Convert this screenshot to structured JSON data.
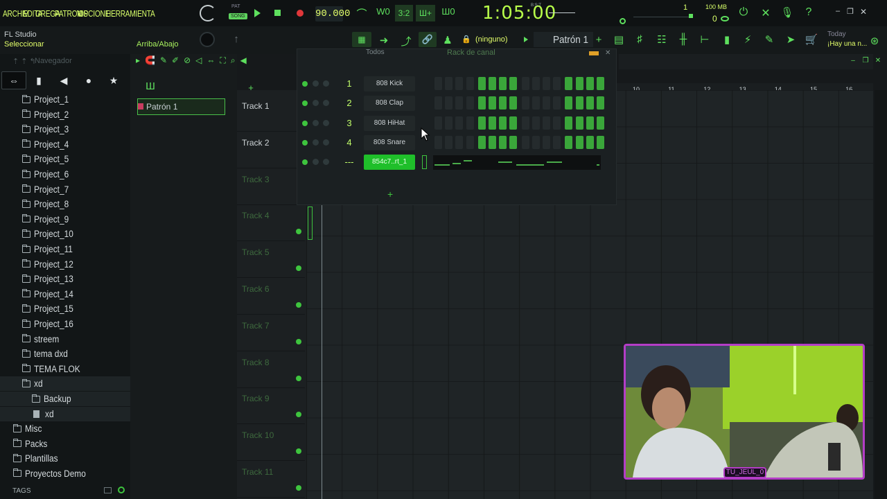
{
  "menu": [
    "ARCHIV",
    "EDITA",
    "GREGA",
    "PATRON",
    "VIS",
    "OPCIONE",
    "HERRAMIENTA"
  ],
  "transport": {
    "pat_label": "PAT",
    "song_label": "SONG",
    "tempo": "90.000",
    "time": "1:05:00",
    "time_unit": "B:S:T",
    "cpu": "1",
    "memory_mb": "100 MB",
    "memory_val": "0"
  },
  "toolbar2": {
    "app_name": "FL Studio",
    "mode": "Seleccionar",
    "updown": "Arriba/Abajo",
    "midi_target": "(ninguno)",
    "pattern": "Patrón 1",
    "news_title": "Today",
    "news_text": "¡Hay una n..."
  },
  "browser": {
    "title": "Navegador",
    "items": [
      {
        "label": "Project_1",
        "type": "folder"
      },
      {
        "label": "Project_2",
        "type": "folder"
      },
      {
        "label": "Project_3",
        "type": "folder"
      },
      {
        "label": "Project_4",
        "type": "folder"
      },
      {
        "label": "Project_5",
        "type": "folder"
      },
      {
        "label": "Project_6",
        "type": "folder"
      },
      {
        "label": "Project_7",
        "type": "folder"
      },
      {
        "label": "Project_8",
        "type": "folder"
      },
      {
        "label": "Project_9",
        "type": "folder"
      },
      {
        "label": "Project_10",
        "type": "folder"
      },
      {
        "label": "Project_11",
        "type": "folder"
      },
      {
        "label": "Project_12",
        "type": "folder"
      },
      {
        "label": "Project_13",
        "type": "folder"
      },
      {
        "label": "Project_14",
        "type": "folder"
      },
      {
        "label": "Project_15",
        "type": "folder"
      },
      {
        "label": "Project_16",
        "type": "folder"
      },
      {
        "label": "streem",
        "type": "folder"
      },
      {
        "label": "tema dxd",
        "type": "folder"
      },
      {
        "label": "TEMA FLOK",
        "type": "folder"
      },
      {
        "label": "xd",
        "type": "folder-open"
      },
      {
        "label": "Backup",
        "type": "subfolder"
      },
      {
        "label": "xd",
        "type": "file"
      }
    ],
    "roots": [
      "Misc",
      "Packs",
      "Plantillas",
      "Proyectos Demo"
    ],
    "tags_label": "TAGS"
  },
  "playlist": {
    "pattern_item": "Patrón 1",
    "tracks": [
      "Track 1",
      "Track 2",
      "Track 3",
      "Track 4",
      "Track 5",
      "Track 6",
      "Track 7",
      "Track 8",
      "Track 9",
      "Track 10",
      "Track 11"
    ],
    "bars": [
      "10",
      "11",
      "12",
      "13",
      "14",
      "15",
      "16"
    ]
  },
  "channel_rack": {
    "title": "Rack de canal",
    "filter": "Todos",
    "channels": [
      {
        "num": "1",
        "name": "808 Kick",
        "steps": [
          0,
          0,
          0,
          0,
          1,
          1,
          1,
          1,
          0,
          0,
          0,
          0,
          1,
          1,
          1,
          1
        ]
      },
      {
        "num": "2",
        "name": "808 Clap",
        "steps": [
          0,
          0,
          0,
          0,
          1,
          1,
          1,
          1,
          0,
          0,
          0,
          0,
          1,
          1,
          1,
          1
        ]
      },
      {
        "num": "3",
        "name": "808 HiHat",
        "steps": [
          0,
          0,
          0,
          0,
          1,
          1,
          1,
          1,
          0,
          0,
          0,
          0,
          1,
          1,
          1,
          1
        ]
      },
      {
        "num": "4",
        "name": "808 Snare",
        "steps": [
          0,
          0,
          0,
          0,
          1,
          1,
          1,
          1,
          0,
          0,
          0,
          0,
          1,
          1,
          1,
          1
        ]
      },
      {
        "num": "---",
        "name": "854c7..rt_1",
        "steps": []
      }
    ]
  },
  "webcam": {
    "handle": "TU_JEUL_0"
  },
  "colors": {
    "accent_green": "#3ec43e",
    "lime_text": "#d8ff6a",
    "record_red": "#e0373a",
    "webcam_border": "#b43dc7"
  }
}
